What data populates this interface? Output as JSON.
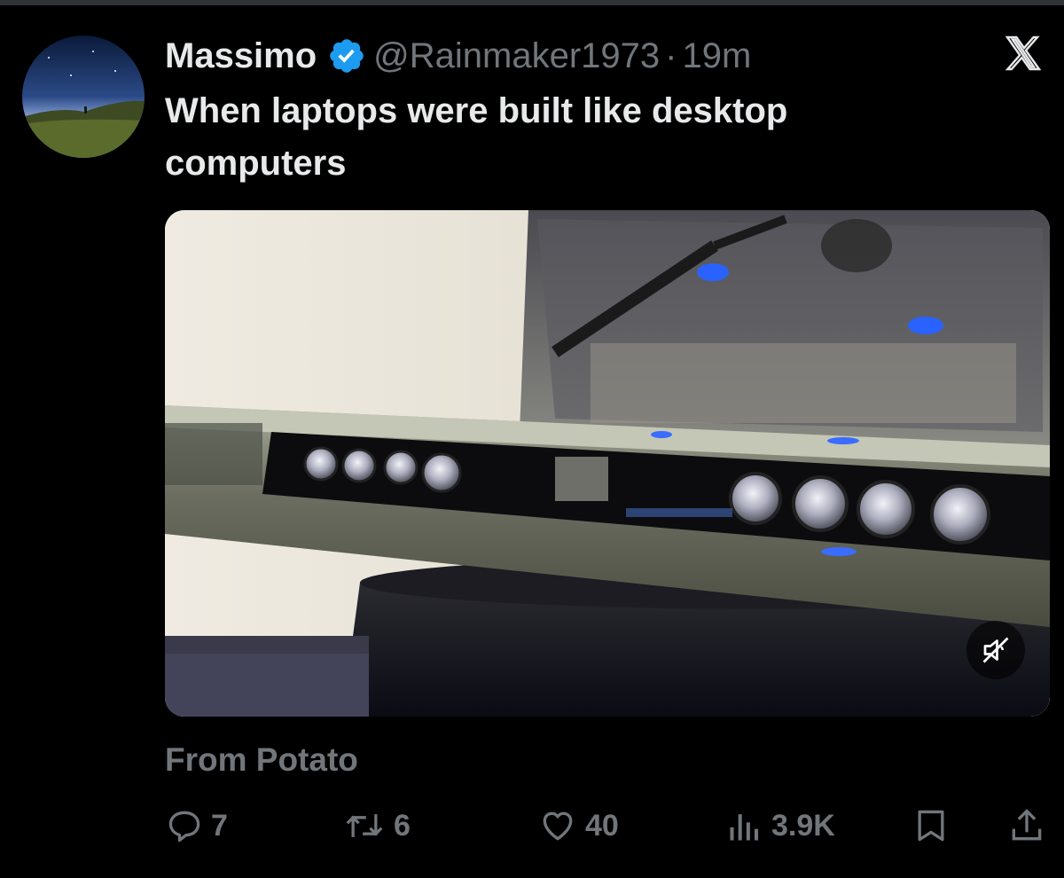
{
  "tweet": {
    "author_name": "Massimo",
    "handle": "@Rainmaker1973",
    "separator": "·",
    "time": "19m",
    "text": "When laptops were built like desktop computers",
    "source": "From Potato"
  },
  "actions": {
    "replies": "7",
    "reposts": "6",
    "likes": "40",
    "views": "3.9K"
  },
  "icons": {
    "avatar": "avatar-icon",
    "verified": "verified-badge-icon",
    "brand": "x-logo-icon",
    "mute": "muted-speaker-icon",
    "reply": "reply-icon",
    "repost": "repost-icon",
    "like": "heart-icon",
    "views": "views-chart-icon",
    "bookmark": "bookmark-icon",
    "share": "share-icon"
  },
  "colors": {
    "background": "#000000",
    "text_primary": "#e7e9ea",
    "text_secondary": "#71767b",
    "verified_blue": "#1d9bf0"
  }
}
